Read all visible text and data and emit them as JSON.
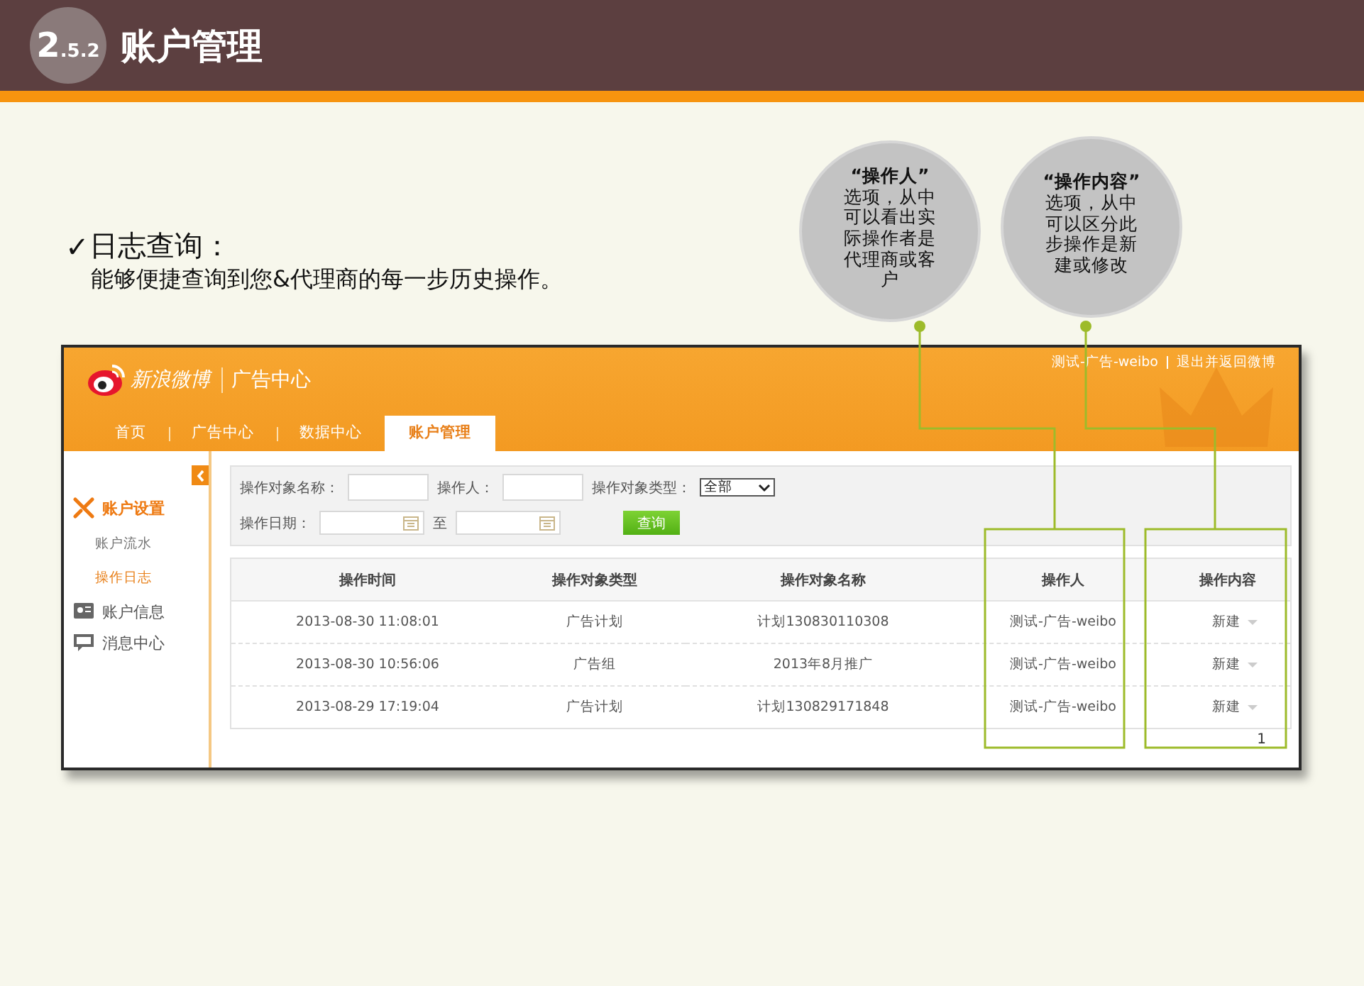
{
  "slide": {
    "section_number": "2",
    "section_sub": ".5.2",
    "title": "账户管理"
  },
  "bullet": {
    "check": "✓",
    "heading": "日志查询：",
    "text": "能够便捷查询到您&代理商的每一步历史操作。"
  },
  "callouts": [
    {
      "heading": "“操作人”",
      "text": "选项，从中可以看出实际操作者是代理商或客户"
    },
    {
      "heading": "“操作内容”",
      "text": "选项，从中可以区分此步操作是新建或修改"
    }
  ],
  "app": {
    "brand": "新浪微博",
    "product": "广告中心",
    "user": "测试-广告-weibo",
    "logout": "退出并返回微博",
    "nav_tabs": [
      {
        "label": "首页",
        "selected": false
      },
      {
        "label": "广告中心",
        "selected": false
      },
      {
        "label": "数据中心",
        "selected": false
      },
      {
        "label": "账户管理",
        "selected": true
      }
    ],
    "sidebar": [
      {
        "label": "账户设置",
        "selected": true,
        "children": [
          {
            "label": "账户流水",
            "selected": false
          },
          {
            "label": "操作日志",
            "selected": true
          }
        ]
      },
      {
        "label": "账户信息",
        "selected": false
      },
      {
        "label": "消息中心",
        "selected": false
      }
    ],
    "filters": {
      "name_label": "操作对象名称：",
      "operator_label": "操作人：",
      "type_label": "操作对象类型：",
      "type_value": "全部",
      "date_label": "操作日期：",
      "date_separator": "至",
      "query_button": "查询"
    },
    "table": {
      "columns": [
        "操作时间",
        "操作对象类型",
        "操作对象名称",
        "操作人",
        "操作内容"
      ],
      "rows": [
        [
          "2013-08-30 11:08:01",
          "广告计划",
          "计划130830110308",
          "测试-广告-weibo",
          "新建"
        ],
        [
          "2013-08-30 10:56:06",
          "广告组",
          "2013年8月推广",
          "测试-广告-weibo",
          "新建"
        ],
        [
          "2013-08-29 17:19:04",
          "广告计划",
          "计划130829171848",
          "测试-广告-weibo",
          "新建"
        ]
      ]
    },
    "pager": "1"
  }
}
